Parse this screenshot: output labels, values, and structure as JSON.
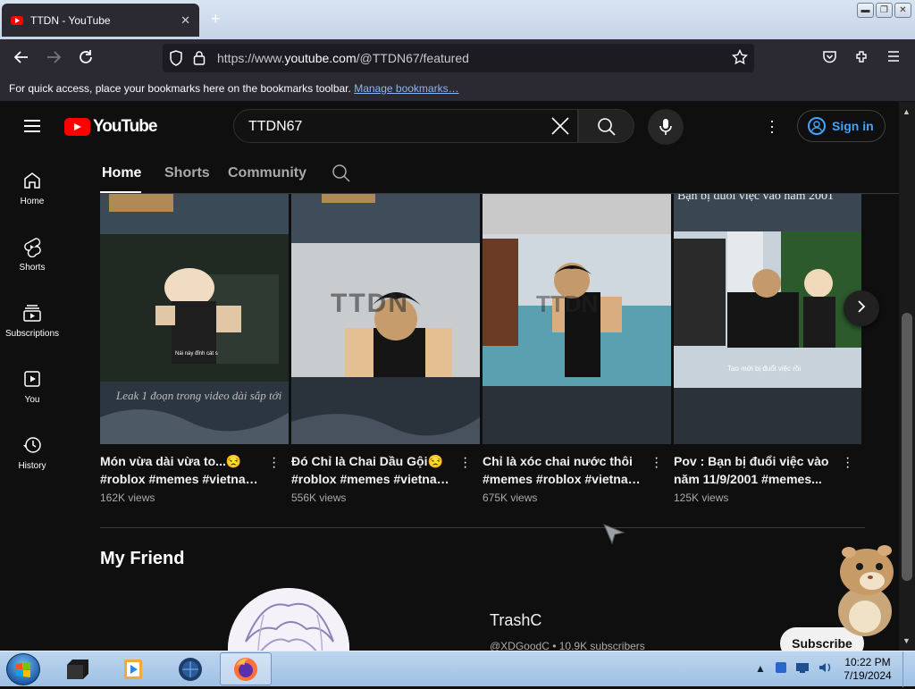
{
  "browser": {
    "tab_title": "TTDN - YouTube",
    "url_prefix": "https://www.",
    "url_domain": "youtube.com",
    "url_path": "/@TTDN67/featured",
    "bookmarks_text": "For quick access, place your bookmarks here on the bookmarks toolbar.",
    "bookmarks_link": "Manage bookmarks…"
  },
  "youtube": {
    "logo_text": "YouTube",
    "search_query": "TTDN67",
    "sign_in": "Sign in",
    "sidebar": [
      {
        "label": "Home",
        "icon": "home-icon"
      },
      {
        "label": "Shorts",
        "icon": "shorts-icon"
      },
      {
        "label": "Subscriptions",
        "icon": "subscriptions-icon"
      },
      {
        "label": "You",
        "icon": "you-icon"
      },
      {
        "label": "History",
        "icon": "history-icon"
      }
    ],
    "tabs": [
      "Home",
      "Shorts",
      "Community"
    ],
    "shorts": [
      {
        "title_line1": "Món vừa dài vừa to...😒",
        "title_line2": "#roblox #memes #vietnam...",
        "views": "162K views",
        "caption_small": "Nái này đỉnh cát s",
        "caption_overlay": "Leak 1 đoạn trong video dài sắp tới"
      },
      {
        "title_line1": "Đó Chỉ là Chai Dầu Gội😒",
        "title_line2": "#roblox #memes #vietnam...",
        "views": "556K views",
        "watermark": "TTDN"
      },
      {
        "title_line1": "Chỉ là xóc chai nước thôi",
        "title_line2": "#memes #roblox #vietnam...",
        "views": "675K views",
        "watermark": "TTDN"
      },
      {
        "title_line1": "Pov : Bạn bị đuổi việc vào",
        "title_line2": "năm 11/9/2001 #memes...",
        "views": "125K views",
        "caption_top": "Bạn bị đuổi việc vào năm 2001",
        "caption_small": "Tao mới bị đuổi việc rồi"
      }
    ],
    "section_title": "My Friend",
    "friend": {
      "name": "TrashC",
      "meta": "@XDGoodC • 10.9K subscribers",
      "subscribe": "Subscribe"
    }
  },
  "taskbar": {
    "time": "10:22 PM",
    "date": "7/19/2024"
  }
}
